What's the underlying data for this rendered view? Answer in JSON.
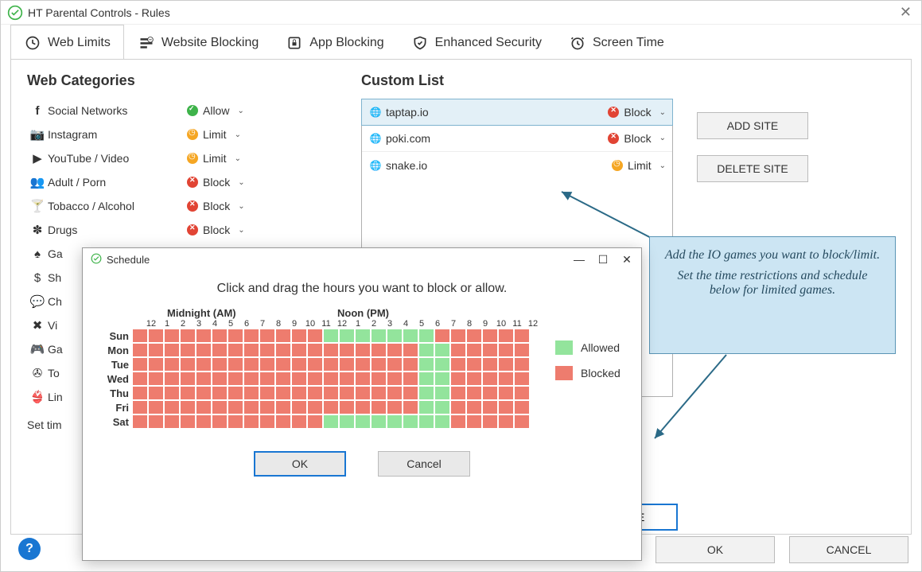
{
  "window": {
    "title": "HT Parental Controls - Rules"
  },
  "tabs": {
    "t0": "Web Limits",
    "t1": "Website Blocking",
    "t2": "App Blocking",
    "t3": "Enhanced Security",
    "t4": "Screen Time"
  },
  "headings": {
    "categories": "Web Categories",
    "custom": "Custom List"
  },
  "categories": [
    {
      "name": "Social Networks",
      "status": "Allow",
      "icon": "facebook"
    },
    {
      "name": "Instagram",
      "status": "Limit",
      "icon": "instagram"
    },
    {
      "name": "YouTube / Video",
      "status": "Limit",
      "icon": "youtube"
    },
    {
      "name": "Adult / Porn",
      "status": "Block",
      "icon": "adult"
    },
    {
      "name": "Tobacco / Alcohol",
      "status": "Block",
      "icon": "alcohol"
    },
    {
      "name": "Drugs",
      "status": "Block",
      "icon": "drugs"
    },
    {
      "name": "Ga",
      "status": "",
      "icon": "games-spade"
    },
    {
      "name": "Sh",
      "status": "",
      "icon": "shopping"
    },
    {
      "name": "Ch",
      "status": "",
      "icon": "chat"
    },
    {
      "name": "Vi",
      "status": "",
      "icon": "violence"
    },
    {
      "name": "Ga",
      "status": "",
      "icon": "gamepad"
    },
    {
      "name": "To",
      "status": "",
      "icon": "torrent"
    },
    {
      "name": "Lin",
      "status": "",
      "icon": "lingerie"
    }
  ],
  "status_labels": {
    "Allow": "Allow",
    "Limit": "Limit",
    "Block": "Block"
  },
  "settime": {
    "label": "Set tim"
  },
  "custom_list": [
    {
      "site": "taptap.io",
      "status": "Block",
      "selected": true
    },
    {
      "site": "poki.com",
      "status": "Block",
      "selected": false
    },
    {
      "site": "snake.io",
      "status": "Limit",
      "selected": false
    }
  ],
  "buttons": {
    "add": "ADD SITE",
    "delete": "DELETE SITE",
    "schedule": "HEDULE",
    "ok": "OK",
    "cancel": "CANCEL"
  },
  "annotation": {
    "line1": "Add the IO games you want to block/limit.",
    "line2": "Set the time restrictions and schedule below for limited games."
  },
  "schedule": {
    "title": "Schedule",
    "instruction": "Click and drag the hours you want to block or allow.",
    "header_am": "Midnight (AM)",
    "header_pm": "Noon (PM)",
    "hours": [
      "12",
      "1",
      "2",
      "3",
      "4",
      "5",
      "6",
      "7",
      "8",
      "9",
      "10",
      "11",
      "12",
      "1",
      "2",
      "3",
      "4",
      "5",
      "6",
      "7",
      "8",
      "9",
      "10",
      "11",
      "12"
    ],
    "days": [
      "Sun",
      "Mon",
      "Tue",
      "Wed",
      "Thu",
      "Fri",
      "Sat"
    ],
    "legend_allowed": "Allowed",
    "legend_blocked": "Blocked",
    "ok": "OK",
    "cancel": "Cancel",
    "grid": [
      "AAAAAAAAAAAABBBBBBBAAAAAA",
      "AAAAAAAAAAAAAAAAAABBAAAAA",
      "AAAAAAAAAAAAAAAAAABBAAAAA",
      "AAAAAAAAAAAAAAAAAABBAAAAA",
      "AAAAAAAAAAAAAAAAAABBAAAAA",
      "AAAAAAAAAAAAAAAAAABBAAAAA",
      "AAAAAAAAAAAABBBBBBBBAAAAA"
    ]
  }
}
